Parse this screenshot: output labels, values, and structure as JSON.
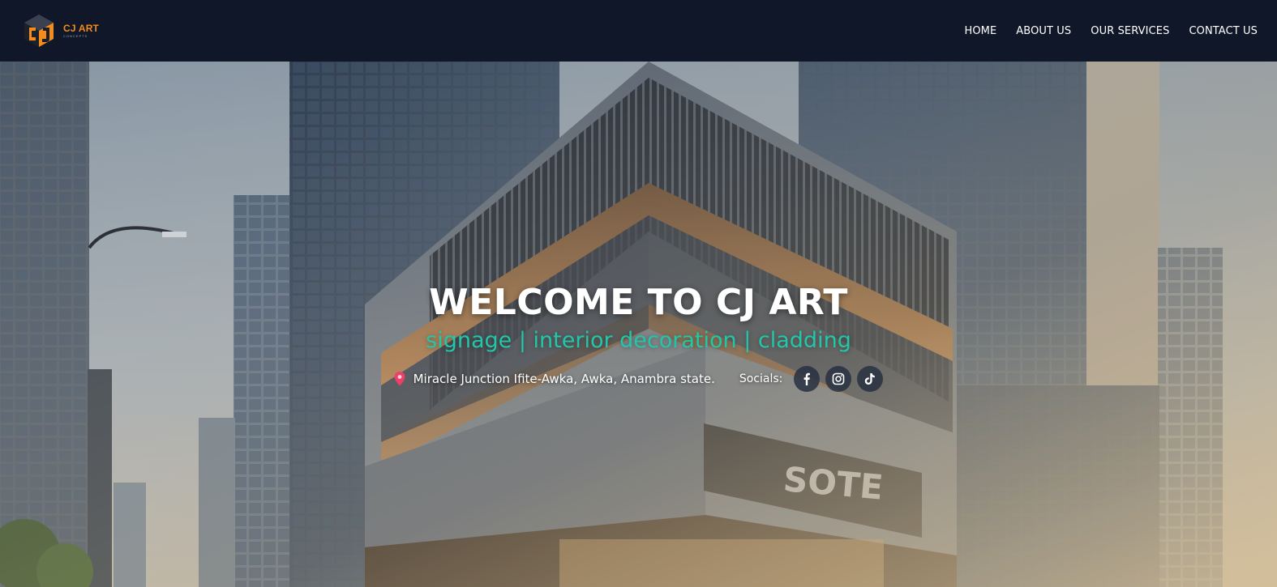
{
  "brand": {
    "name": "CJ ART",
    "sub": "CONCEPTS",
    "accent": "#f28c1c"
  },
  "nav": {
    "items": [
      {
        "label": "HOME"
      },
      {
        "label": "ABOUT US"
      },
      {
        "label": "OUR SERVICES"
      },
      {
        "label": "CONTACT US"
      }
    ]
  },
  "hero": {
    "title": "WELCOME TO CJ ART",
    "tagline": "signage | interior decoration | cladding",
    "tagline_color": "#22c6a8",
    "location": {
      "icon": "map-pin-icon",
      "text": "Miracle Junction Ifite-Awka, Awka, Anambra state."
    },
    "socials": {
      "label": "Socials:",
      "items": [
        {
          "icon": "facebook-icon"
        },
        {
          "icon": "instagram-icon"
        },
        {
          "icon": "tiktok-icon"
        }
      ]
    },
    "building_sign": "SOTE"
  }
}
